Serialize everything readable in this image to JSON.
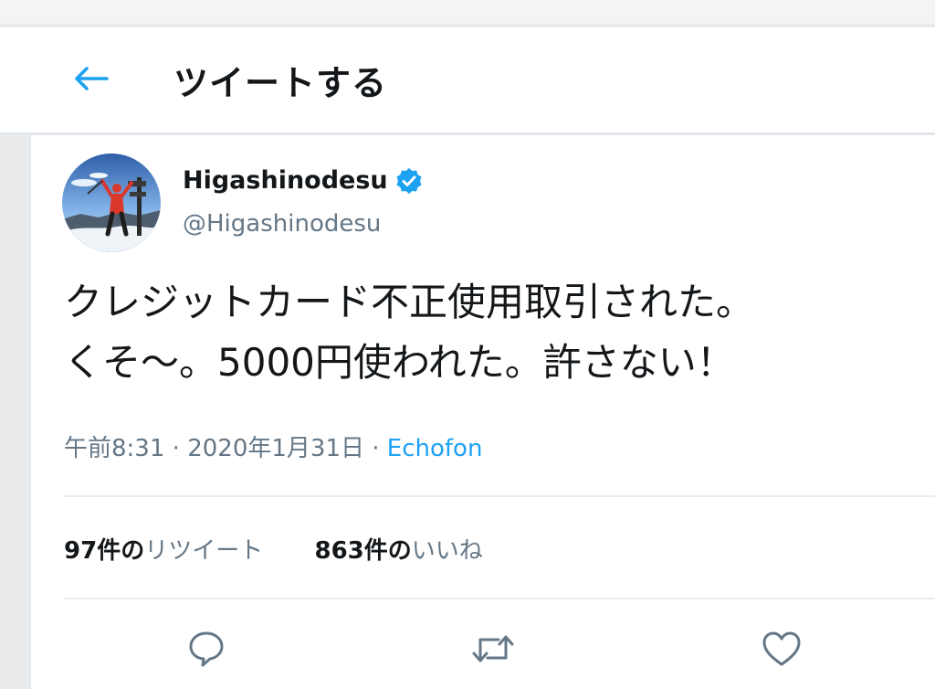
{
  "header": {
    "back_icon": "arrow-left-icon",
    "title": "ツイートする"
  },
  "tweet": {
    "avatar_icon": "profile-photo",
    "display_name": "Higashinodesu",
    "verified_icon": "verified-badge-icon",
    "handle": "@Higashinodesu",
    "text_line1": "クレジットカード不正使用取引された。",
    "text_line2": "くそ〜。5000円使われた。許さない！",
    "time": "午前8:31",
    "date": "2020年1月31日",
    "separator": "·",
    "source": "Echofon"
  },
  "stats": {
    "retweets_count": "97",
    "retweets_label_prefix": "件の",
    "retweets_label": "リツイート",
    "likes_count": "863",
    "likes_label_prefix": "件の",
    "likes_label": "いいね"
  },
  "actions": [
    {
      "icon": "reply-icon"
    },
    {
      "icon": "retweet-icon"
    },
    {
      "icon": "like-icon"
    }
  ],
  "colors": {
    "accent": "#1da1f2",
    "text": "#14171a",
    "secondary": "#657786",
    "divider": "#e6ecf0"
  }
}
